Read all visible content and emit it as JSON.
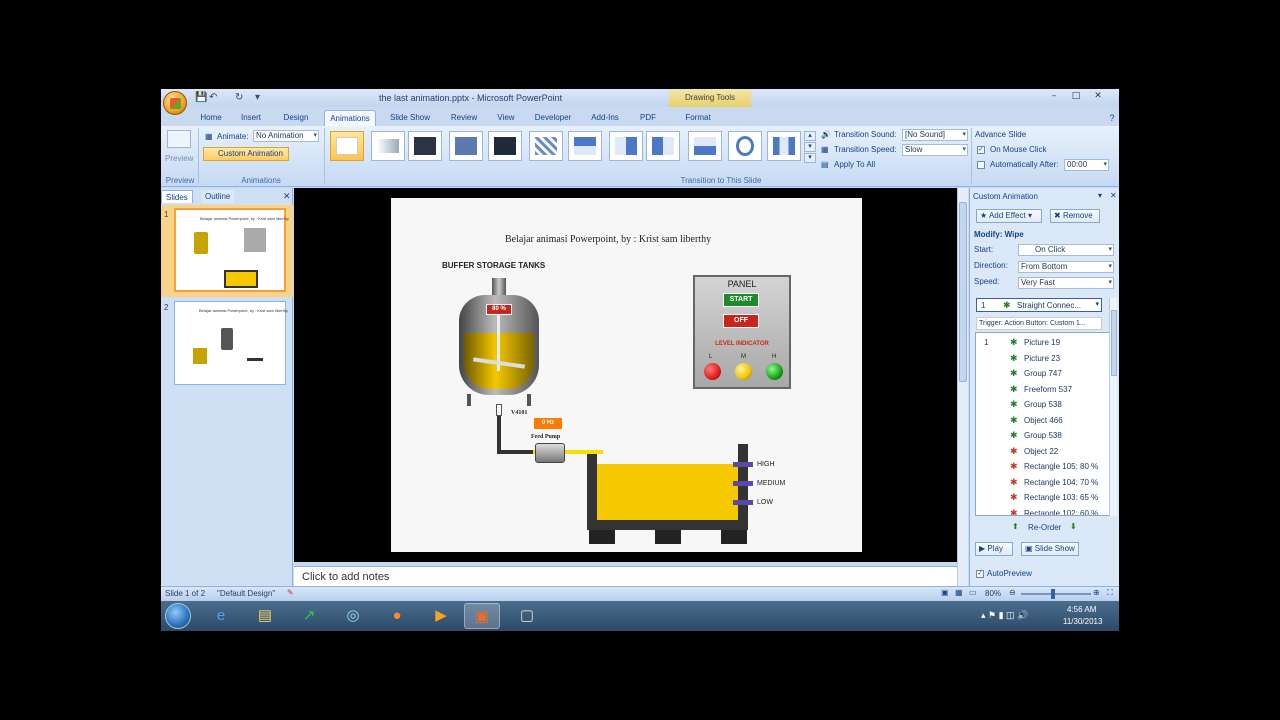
{
  "window": {
    "title": "the last animation.pptx - Microsoft PowerPoint",
    "contextual_tab": "Drawing Tools"
  },
  "tabs": [
    "Home",
    "Insert",
    "Design",
    "Animations",
    "Slide Show",
    "Review",
    "View",
    "Developer",
    "Add-Ins",
    "PDF",
    "Format"
  ],
  "ribbon": {
    "preview": {
      "button": "Preview",
      "group": "Preview"
    },
    "animations": {
      "animate_label": "Animate:",
      "animate_value": "No Animation",
      "custom_button": "Custom Animation",
      "group": "Animations"
    },
    "transition": {
      "sound_label": "Transition Sound:",
      "sound_value": "[No Sound]",
      "speed_label": "Transition Speed:",
      "speed_value": "Slow",
      "apply_all": "Apply To All",
      "group": "Transition to This Slide"
    },
    "advance": {
      "title": "Advance Slide",
      "on_click": "On Mouse Click",
      "auto_after": "Automatically After:",
      "auto_value": "00:00"
    }
  },
  "left_pane": {
    "tabs": [
      "Slides",
      "Outline"
    ],
    "slides": [
      {
        "number": "1",
        "caption": "Belajar animasi Powerpoint, by : Krist sam liberthy"
      },
      {
        "number": "2",
        "caption": "Belajar animasi Powerpoint, by : Krist sam liberthy"
      }
    ]
  },
  "slide": {
    "title": "Belajar animasi Powerpoint, by : Krist sam liberthy",
    "heading": "BUFFER STORAGE TANKS",
    "tank_percent": "80 %",
    "valve_label": "V4101",
    "pump_hz": "0 Hz",
    "pump_label": "Feed Pump",
    "panel_title": "PANEL",
    "start_label": "START",
    "off_label": "OFF",
    "level_indicator": "LEVEL INDICATOR",
    "lamp_labels": [
      "L",
      "M",
      "H"
    ],
    "level_labels": [
      "HIGH",
      "MEDIUM",
      "LOW"
    ],
    "colors": {
      "tank_fill": "#f5c800",
      "start": "#1f8a2a",
      "off": "#c8261c",
      "lamp_l": "#e21b1b",
      "lamp_m": "#f3c300",
      "lamp_h": "#18a016"
    }
  },
  "notes_placeholder": "Click to add notes",
  "custom_animation": {
    "title": "Custom Animation",
    "add_effect": "Add Effect",
    "remove": "Remove",
    "modify": "Modify: Wipe",
    "start_label": "Start:",
    "start_value": "On Click",
    "direction_label": "Direction:",
    "direction_value": "From Bottom",
    "speed_label": "Speed:",
    "speed_value": "Very Fast",
    "selected_item": "Straight Connec...",
    "trigger": "Trigger: Action Button: Custom 1...",
    "items": [
      {
        "num": "1",
        "name": "Picture 19",
        "color": "#2a7a2a"
      },
      {
        "num": "",
        "name": "Picture 23",
        "color": "#2a7a2a"
      },
      {
        "num": "",
        "name": "Group 747",
        "color": "#2a7a2a"
      },
      {
        "num": "",
        "name": "Freeform 537",
        "color": "#2a7a2a"
      },
      {
        "num": "",
        "name": "Group 538",
        "color": "#2a7a2a"
      },
      {
        "num": "",
        "name": "Object 466",
        "color": "#2a7a2a"
      },
      {
        "num": "",
        "name": "Group 538",
        "color": "#2a7a2a"
      },
      {
        "num": "",
        "name": "Object 22",
        "color": "#c0392b"
      },
      {
        "num": "",
        "name": "Rectangle 105: 80 %",
        "color": "#c0392b"
      },
      {
        "num": "",
        "name": "Rectangle 104: 70 %",
        "color": "#c0392b"
      },
      {
        "num": "",
        "name": "Rectangle 103: 65 %",
        "color": "#c0392b"
      },
      {
        "num": "",
        "name": "Rectangle 102: 60 %",
        "color": "#c0392b"
      }
    ],
    "reorder": "Re-Order",
    "play": "Play",
    "slide_show": "Slide Show",
    "autopreview": "AutoPreview"
  },
  "status": {
    "slide": "Slide 1 of 2",
    "theme": "\"Default Design\"",
    "zoom": "80%"
  },
  "taskbar": {
    "time": "4:56 AM",
    "date": "11/30/2013"
  }
}
